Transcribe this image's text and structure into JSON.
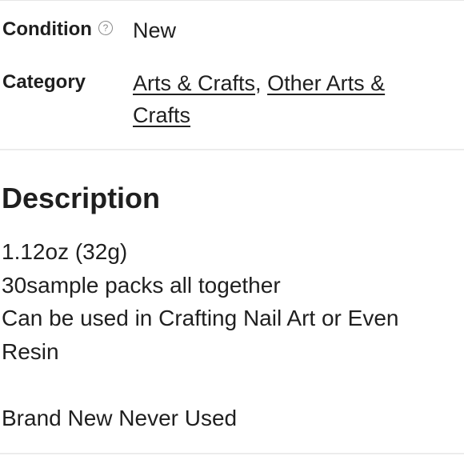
{
  "details": {
    "condition": {
      "label": "Condition",
      "value": "New",
      "info_icon": "question-circle-icon"
    },
    "category": {
      "label": "Category",
      "links": [
        "Arts & Crafts",
        "Other Arts & Crafts"
      ],
      "separator": ","
    }
  },
  "description": {
    "heading": "Description",
    "lines": [
      "1.12oz (32g)",
      "30sample packs all together",
      "Can be used in Crafting Nail Art or Even",
      "Resin",
      "",
      "Brand New Never Used"
    ]
  }
}
